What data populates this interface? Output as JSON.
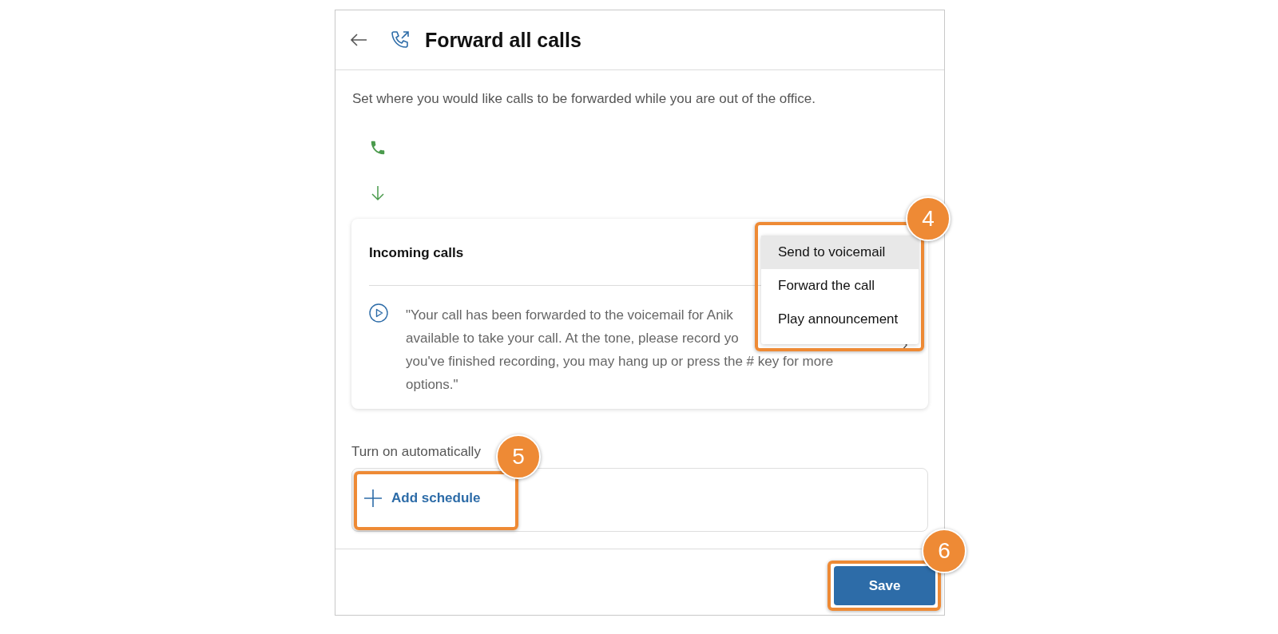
{
  "header": {
    "title": "Forward all calls"
  },
  "description": "Set where you would like calls to be forwarded while you are out of the office.",
  "incoming": {
    "title": "Incoming calls",
    "message_lines": [
      "\"Your call has been forwarded to the voicemail for Anik",
      "available to take your call. At the tone, please record yo",
      "you've finished recording, you may hang up or press the # key for more",
      "options.\""
    ],
    "chevron": "›",
    "dropdown": {
      "callout": "4",
      "options": [
        {
          "label": "Send to voicemail",
          "selected": true
        },
        {
          "label": "Forward the call",
          "selected": false
        },
        {
          "label": "Play announcement",
          "selected": false
        }
      ]
    }
  },
  "schedule": {
    "label": "Turn on automatically",
    "button": "Add schedule",
    "callout": "5"
  },
  "footer": {
    "button": "Save",
    "callout": "6"
  }
}
